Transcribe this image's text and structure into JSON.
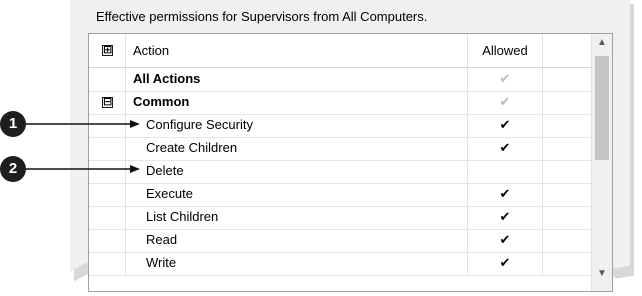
{
  "panel": {
    "caption": "Effective permissions for Supervisors from All Computers."
  },
  "grid": {
    "header": {
      "expand_glyph": "⊞",
      "action_label": "Action",
      "allowed_label": "Allowed"
    },
    "rows": [
      {
        "action": "All Actions",
        "allowed": "✔",
        "allowed_state": "inherited",
        "style": "bold"
      },
      {
        "action": "Common",
        "allowed": "✔",
        "allowed_state": "inherited",
        "style": "bold-group",
        "collapse_glyph": "⊟"
      },
      {
        "action": "Configure Security",
        "allowed": "✔",
        "allowed_state": "explicit",
        "style": "child"
      },
      {
        "action": "Create Children",
        "allowed": "✔",
        "allowed_state": "explicit",
        "style": "child"
      },
      {
        "action": "Delete",
        "allowed": "",
        "allowed_state": "none",
        "style": "child"
      },
      {
        "action": "Execute",
        "allowed": "✔",
        "allowed_state": "explicit",
        "style": "child"
      },
      {
        "action": "List Children",
        "allowed": "✔",
        "allowed_state": "explicit",
        "style": "child"
      },
      {
        "action": "Read",
        "allowed": "✔",
        "allowed_state": "explicit",
        "style": "child"
      },
      {
        "action": "Write",
        "allowed": "✔",
        "allowed_state": "explicit",
        "style": "child"
      }
    ],
    "scrollbar": {
      "up_glyph": "▲",
      "down_glyph": "▼"
    }
  },
  "callouts": [
    {
      "number": "1",
      "target_row": "Configure Security"
    },
    {
      "number": "2",
      "target_row": "Delete"
    }
  ],
  "colors": {
    "panel_bg": "#f0f0f0",
    "grid_bg": "#ffffff",
    "inherited_check": "#b9b9b9",
    "explicit_check": "#000000",
    "callout_fill": "#1e1e1e"
  }
}
